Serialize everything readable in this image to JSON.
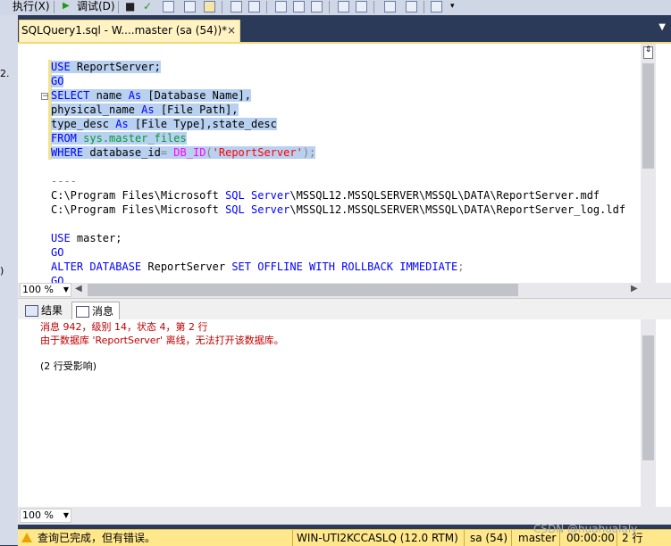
{
  "toolbar": {
    "execute_label": "执行(X)",
    "debug_label": "调试(D)"
  },
  "left_fragments": [
    "2.",
    ")"
  ],
  "document_tab": {
    "title": "SQLQuery1.sql - W....master (sa (54))*",
    "close": "×"
  },
  "editor": {
    "lines": {
      "l1": [
        "USE",
        " ReportServer;"
      ],
      "l2": "GO",
      "l3": [
        "SELECT",
        " name ",
        "As",
        " [Database Name],"
      ],
      "l4": [
        "physical_name ",
        "As",
        " [File Path],"
      ],
      "l5": [
        "type_desc ",
        "As",
        " [File Type],state_desc"
      ],
      "l6": [
        "FROM",
        " ",
        "sys.master_files"
      ],
      "l7": [
        "WHERE",
        " database_id",
        "=",
        " ",
        "DB_ID",
        "(",
        "'ReportServer'",
        ");"
      ],
      "l8": "----",
      "l9": [
        "C",
        ":\\Program Files\\Microsoft ",
        "SQL",
        " ",
        "Server",
        "\\MSSQL12.MSSQLSERVER\\MSSQL\\DATA\\ReportServer.mdf"
      ],
      "l10": [
        "C",
        ":\\Program Files\\Microsoft ",
        "SQL",
        " ",
        "Server",
        "\\MSSQL12.MSSQLSERVER\\MSSQL\\DATA\\ReportServer_log.ldf"
      ],
      "l11": [
        "USE",
        " master;"
      ],
      "l12": "GO",
      "l13": [
        "ALTER",
        " ",
        "DATABASE",
        " ReportServer ",
        "SET",
        " ",
        "OFFLINE",
        " ",
        "WITH",
        " ",
        "ROLLBACK",
        " ",
        "IMMEDIATE",
        ";"
      ],
      "l14": "GO"
    },
    "zoom": "100 %"
  },
  "results": {
    "tab_results": "结果",
    "tab_messages": "消息",
    "messages": [
      "消息 942，级别 14，状态 4，第 2 行",
      "由于数据库 'ReportServer' 离线，无法打开该数据库。",
      "(2 行受影响)"
    ],
    "zoom": "100 %"
  },
  "status": {
    "message": "查询已完成，但有错误。",
    "server": "WIN-UTI2KCCASLQ (12.0 RTM)",
    "login": "sa (54)",
    "database": "master",
    "elapsed": "00:00:00",
    "rows": "2 行"
  },
  "watermark": "CSDN @huahualaly",
  "colors": {
    "keyword": "#0000ff",
    "string": "#ff0000",
    "system_object": "#009933",
    "function": "#ff00ff",
    "selection": "#b9d1f0",
    "error": "#c00000",
    "status_bar": "#ffe88b"
  }
}
